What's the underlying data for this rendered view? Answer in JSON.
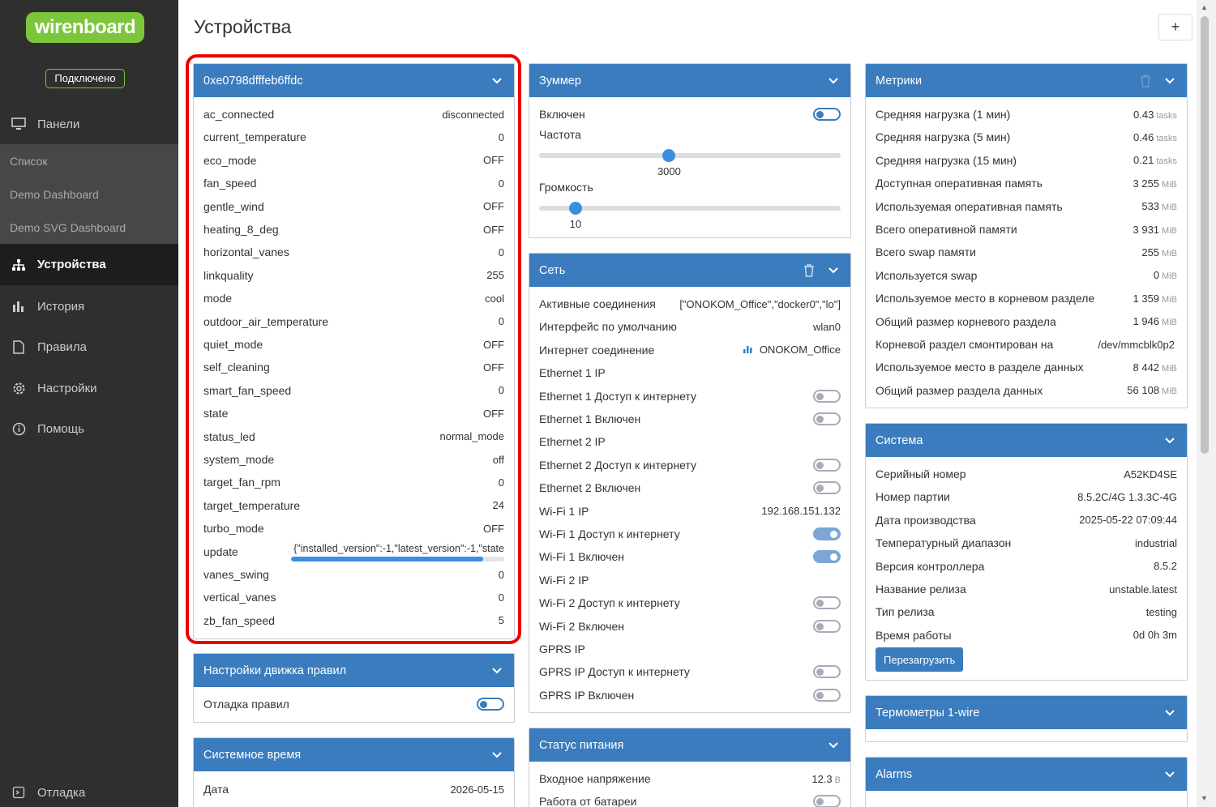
{
  "sidebar": {
    "logo": "wirenboard",
    "status": "Подключено",
    "items": [
      {
        "label": "Панели",
        "icon": "monitor-icon"
      },
      {
        "label": "Список"
      },
      {
        "label": "Demo Dashboard"
      },
      {
        "label": "Demo SVG Dashboard"
      },
      {
        "label": "Устройства",
        "icon": "devices-icon"
      },
      {
        "label": "История",
        "icon": "bar-chart-icon"
      },
      {
        "label": "Правила",
        "icon": "file-icon"
      },
      {
        "label": "Настройки",
        "icon": "gear-icon"
      },
      {
        "label": "Помощь",
        "icon": "info-icon"
      },
      {
        "label": "Отладка",
        "icon": "debug-icon"
      }
    ]
  },
  "page": {
    "title": "Устройства",
    "add_button": "+"
  },
  "device": {
    "title": "0xe0798dfffeb6ffdc",
    "rows": [
      {
        "k": "ac_connected",
        "v": "disconnected"
      },
      {
        "k": "current_temperature",
        "v": "0"
      },
      {
        "k": "eco_mode",
        "v": "OFF"
      },
      {
        "k": "fan_speed",
        "v": "0"
      },
      {
        "k": "gentle_wind",
        "v": "OFF"
      },
      {
        "k": "heating_8_deg",
        "v": "OFF"
      },
      {
        "k": "horizontal_vanes",
        "v": "0"
      },
      {
        "k": "linkquality",
        "v": "255"
      },
      {
        "k": "mode",
        "v": "cool"
      },
      {
        "k": "outdoor_air_temperature",
        "v": "0"
      },
      {
        "k": "quiet_mode",
        "v": "OFF"
      },
      {
        "k": "self_cleaning",
        "v": "OFF"
      },
      {
        "k": "smart_fan_speed",
        "v": "0"
      },
      {
        "k": "state",
        "v": "OFF"
      },
      {
        "k": "status_led",
        "v": "normal_mode"
      },
      {
        "k": "system_mode",
        "v": "off"
      },
      {
        "k": "target_fan_rpm",
        "v": "0"
      },
      {
        "k": "target_temperature",
        "v": "24"
      },
      {
        "k": "turbo_mode",
        "v": "OFF"
      },
      {
        "k": "update",
        "v": "{\"installed_version\":-1,\"latest_version\":-1,\"state"
      },
      {
        "k": "vanes_swing",
        "v": "0"
      },
      {
        "k": "vertical_vanes",
        "v": "0"
      },
      {
        "k": "zb_fan_speed",
        "v": "5"
      }
    ],
    "update_progress": 0.9
  },
  "rules_engine": {
    "title": "Настройки движка правил",
    "debug_label": "Отладка правил"
  },
  "system_time": {
    "title": "Системное время",
    "date_label": "Дата",
    "date_value": "2026-05-15"
  },
  "buzzer": {
    "title": "Зуммер",
    "enabled_label": "Включен",
    "freq_label": "Частота",
    "freq_value": "3000",
    "freq_fraction": 0.43,
    "vol_label": "Громкость",
    "vol_value": "10",
    "vol_fraction": 0.12
  },
  "network": {
    "title": "Сеть",
    "rows": [
      {
        "k": "Активные соединения",
        "v": "[\"ONOKOM_Office\",\"docker0\",\"lo\"]"
      },
      {
        "k": "Интерфейс по умолчанию",
        "v": "wlan0"
      },
      {
        "k": "Интернет соединение",
        "v": "ONOKOM_Office"
      },
      {
        "k": "Ethernet 1 IP",
        "v": ""
      },
      {
        "k": "Ethernet 1 Доступ к интернету",
        "tog": "off"
      },
      {
        "k": "Ethernet 1 Включен",
        "tog": "off"
      },
      {
        "k": "Ethernet 2 IP",
        "v": ""
      },
      {
        "k": "Ethernet 2 Доступ к интернету",
        "tog": "off"
      },
      {
        "k": "Ethernet 2 Включен",
        "tog": "off"
      },
      {
        "k": "Wi-Fi 1 IP",
        "v": "192.168.151.132"
      },
      {
        "k": "Wi-Fi 1 Доступ к интернету",
        "tog": "on"
      },
      {
        "k": "Wi-Fi 1 Включен",
        "tog": "on"
      },
      {
        "k": "Wi-Fi 2 IP",
        "v": ""
      },
      {
        "k": "Wi-Fi 2 Доступ к интернету",
        "tog": "off"
      },
      {
        "k": "Wi-Fi 2 Включен",
        "tog": "off"
      },
      {
        "k": "GPRS IP",
        "v": ""
      },
      {
        "k": "GPRS IP Доступ к интернету",
        "tog": "off"
      },
      {
        "k": "GPRS IP Включен",
        "tog": "off"
      }
    ]
  },
  "power": {
    "title": "Статус питания",
    "rows": [
      {
        "k": "Входное напряжение",
        "v": "12.3",
        "u": "В"
      },
      {
        "k": "Работа от батареи",
        "tog": "off"
      }
    ]
  },
  "metrics": {
    "title": "Метрики",
    "rows": [
      {
        "k": "Средняя нагрузка (1 мин)",
        "v": "0.43",
        "u": "tasks"
      },
      {
        "k": "Средняя нагрузка (5 мин)",
        "v": "0.46",
        "u": "tasks"
      },
      {
        "k": "Средняя нагрузка (15 мин)",
        "v": "0.21",
        "u": "tasks"
      },
      {
        "k": "Доступная оперативная память",
        "v": "3 255",
        "u": "MiB"
      },
      {
        "k": "Используемая оперативная память",
        "v": "533",
        "u": "MiB"
      },
      {
        "k": "Всего оперативной памяти",
        "v": "3 931",
        "u": "MiB"
      },
      {
        "k": "Всего swap памяти",
        "v": "255",
        "u": "MiB"
      },
      {
        "k": "Используется swap",
        "v": "0",
        "u": "MiB"
      },
      {
        "k": "Используемое место в корневом разделе",
        "v": "1 359",
        "u": "MiB"
      },
      {
        "k": "Общий размер корневого раздела",
        "v": "1 946",
        "u": "MiB"
      },
      {
        "k": "Корневой раздел смонтирован на",
        "v": "/dev/mmcblk0p2",
        "u": ""
      },
      {
        "k": "Используемое место в разделе данных",
        "v": "8 442",
        "u": "MiB"
      },
      {
        "k": "Общий размер раздела данных",
        "v": "56 108",
        "u": "MiB"
      }
    ]
  },
  "system": {
    "title": "Система",
    "rows": [
      {
        "k": "Серийный номер",
        "v": "A52KD4SE"
      },
      {
        "k": "Номер партии",
        "v": "8.5.2C/4G 1.3.3C-4G"
      },
      {
        "k": "Дата производства",
        "v": "2025-05-22 07:09:44"
      },
      {
        "k": "Температурный диапазон",
        "v": "industrial"
      },
      {
        "k": "Версия контроллера",
        "v": "8.5.2"
      },
      {
        "k": "Название релиза",
        "v": "unstable.latest"
      },
      {
        "k": "Тип релиза",
        "v": "testing"
      },
      {
        "k": "Время работы",
        "v": "0d 0h 3m"
      }
    ],
    "reboot_button": "Перезагрузить"
  },
  "thermometers": {
    "title": "Термометры 1-wire"
  },
  "alarms": {
    "title": "Alarms"
  },
  "colors": {
    "header": "#3a7cbe",
    "sidebar": "#2f2f2f",
    "accent": "#7cc63b",
    "highlight": "#e00000"
  }
}
